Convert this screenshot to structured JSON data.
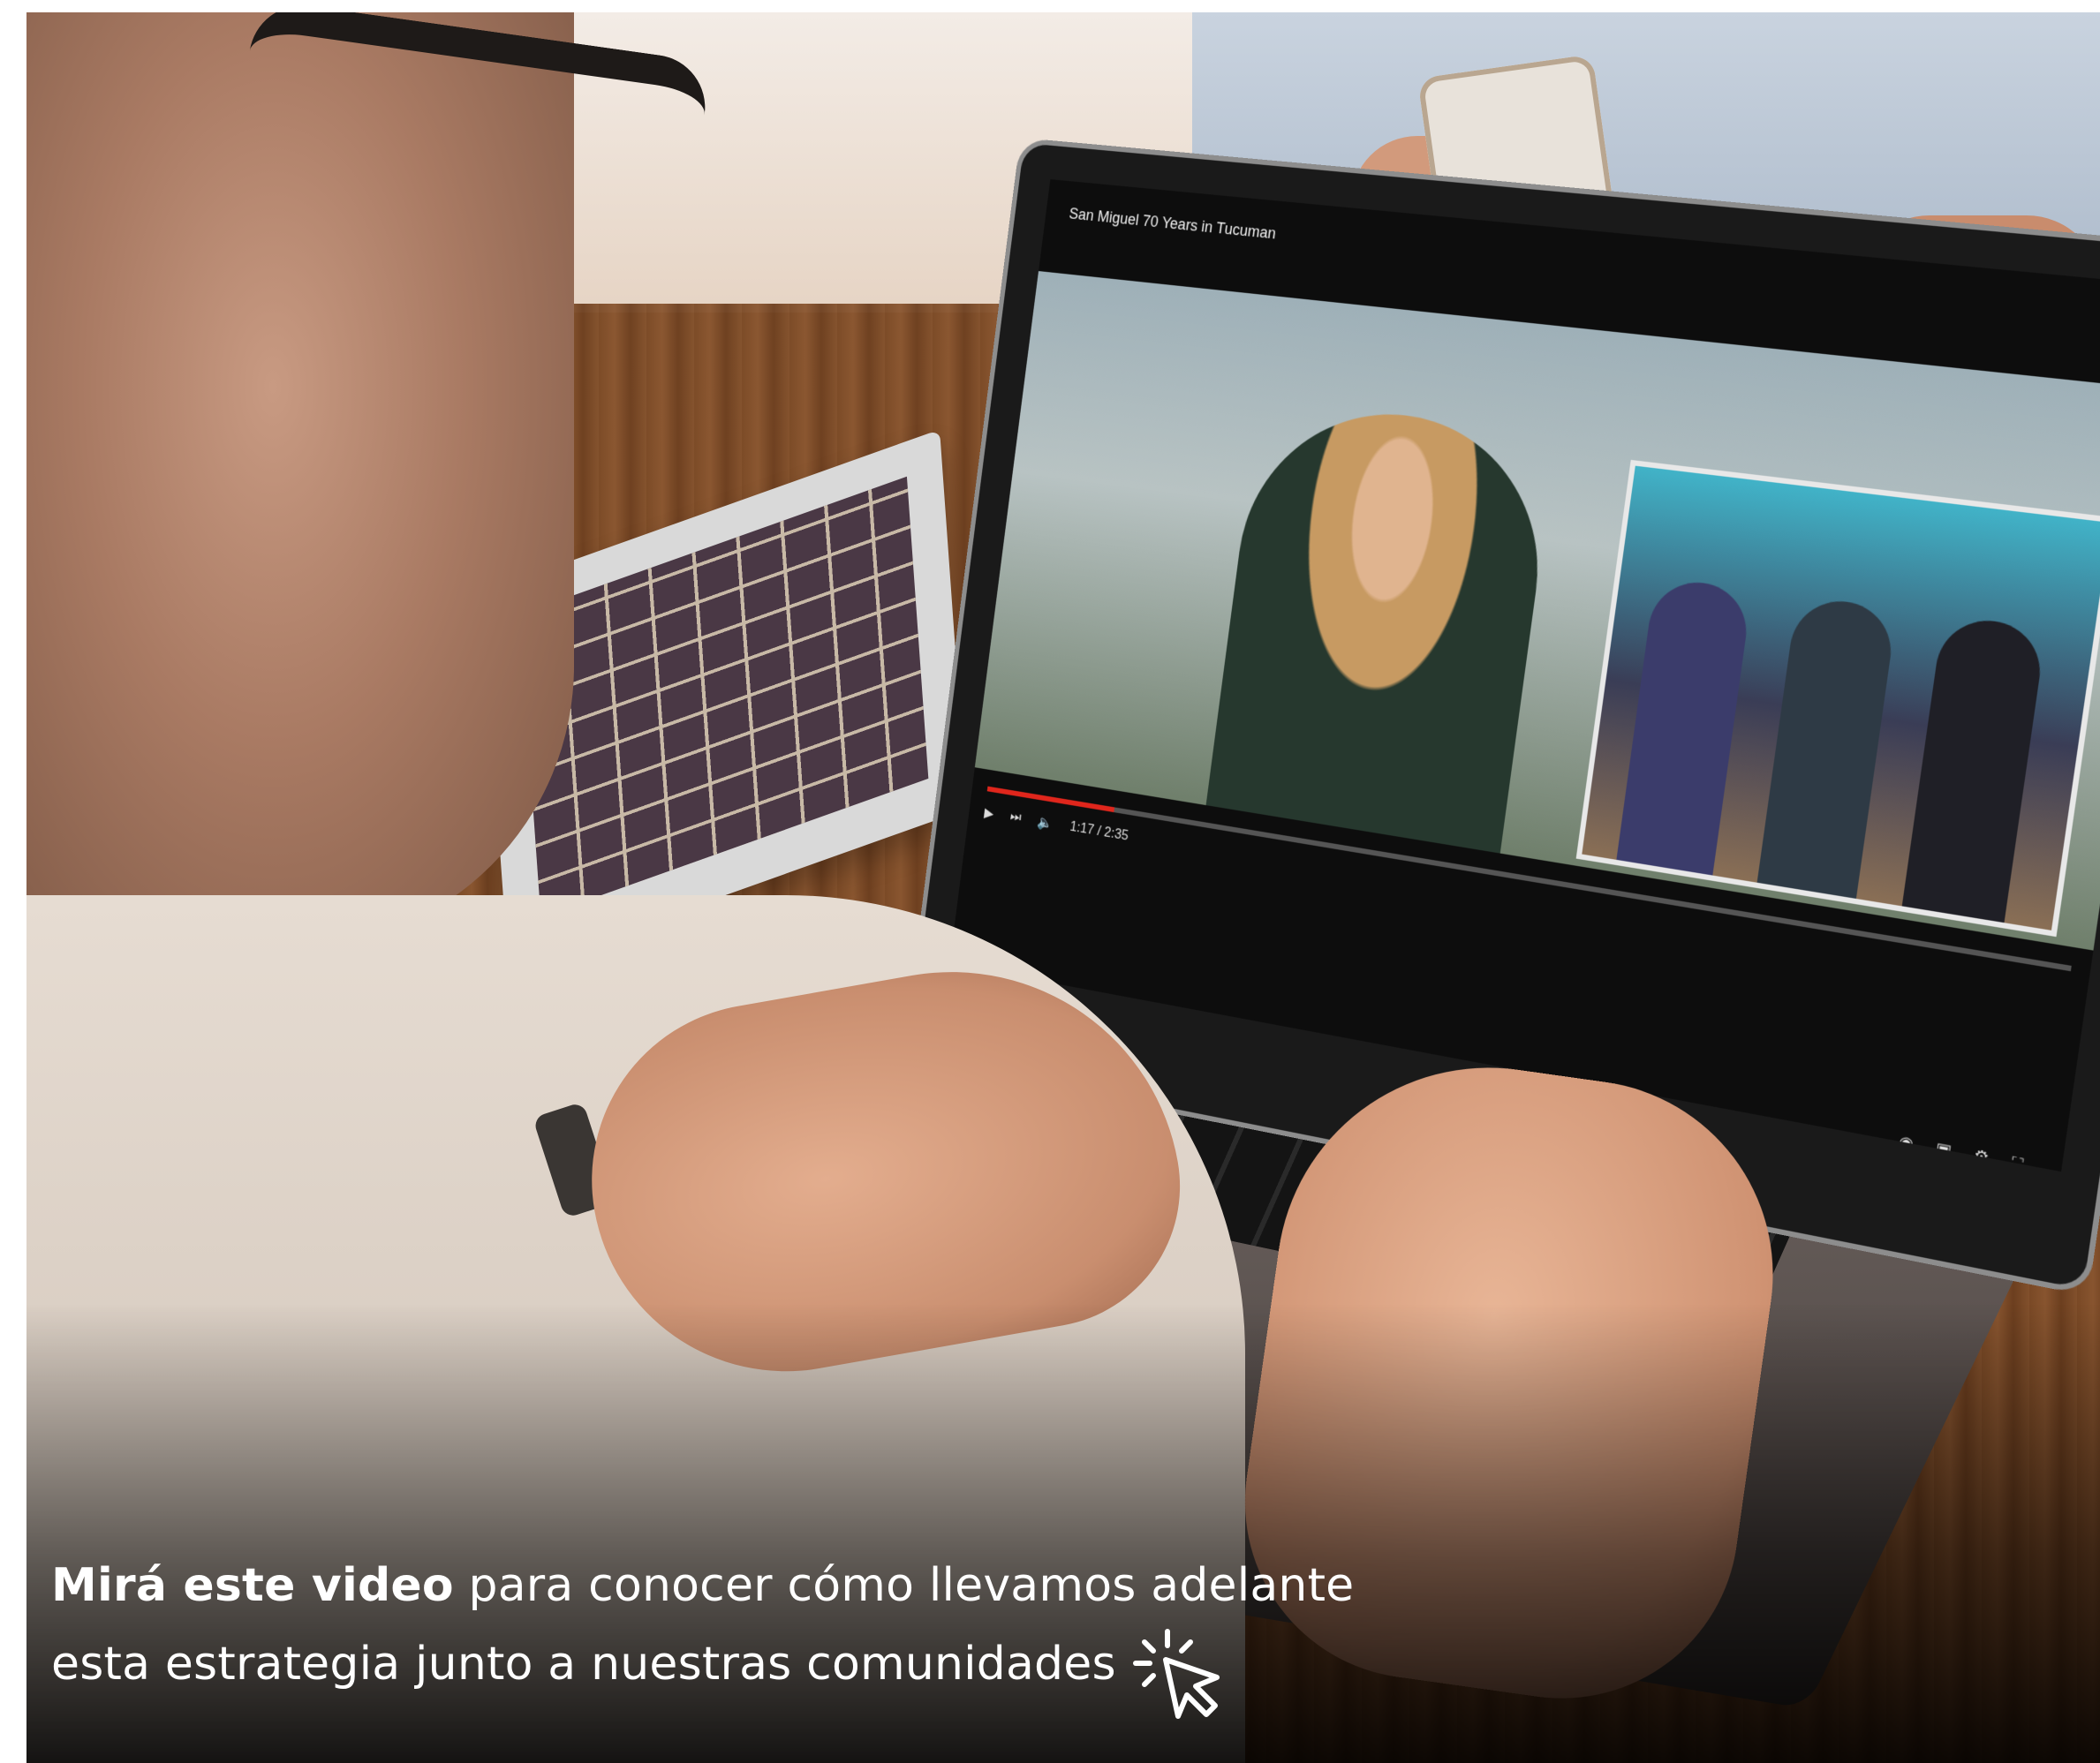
{
  "video": {
    "title": "San Miguel 70 Years in Tucuman",
    "time": "1:17 / 2:35",
    "progress_fraction": 0.13
  },
  "caption": {
    "bold": "Mirá este video",
    "line1_rest": " para conocer cómo llevamos adelante",
    "line2": "esta estrategia junto a nuestras comunidades"
  },
  "icons": {
    "click_cursor": "cursor-click-icon",
    "play": "play-icon",
    "next": "next-icon",
    "volume": "volume-icon",
    "settings": "gear-icon",
    "fullscreen": "fullscreen-icon"
  },
  "colors": {
    "caption_text": "#ffffff",
    "progress": "#e0261c"
  }
}
